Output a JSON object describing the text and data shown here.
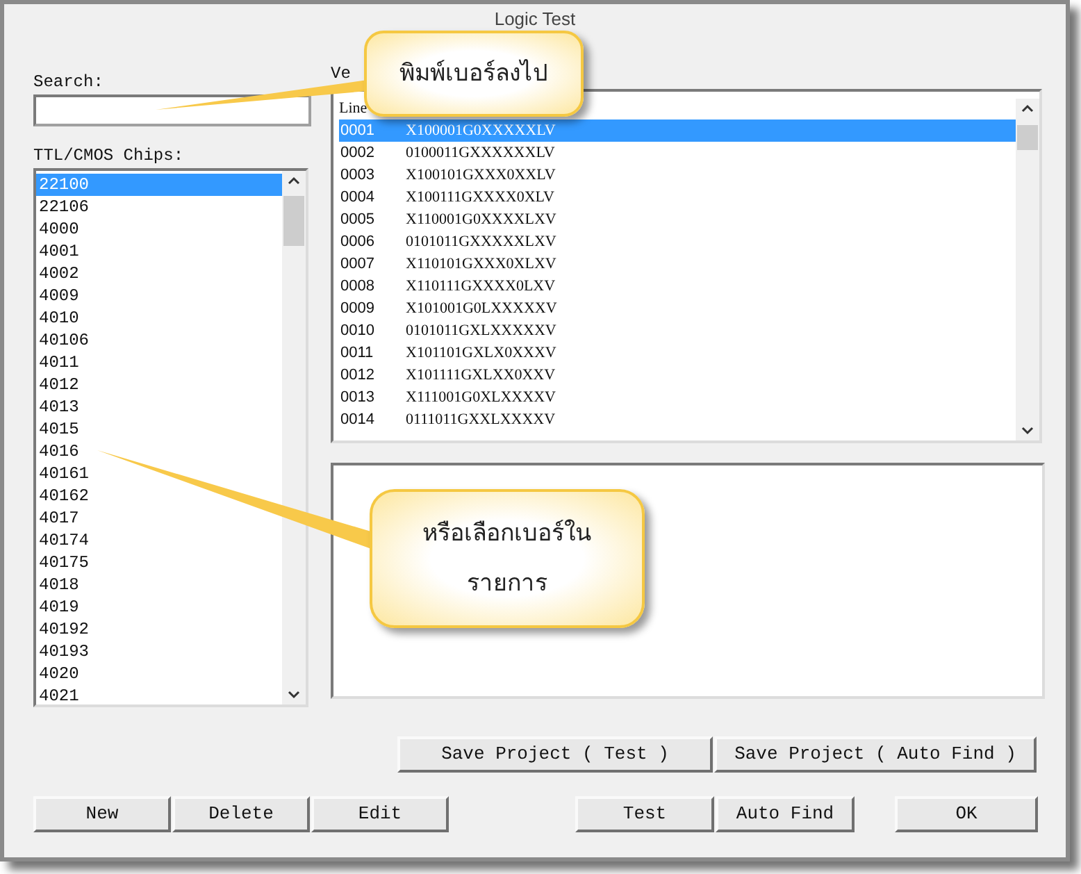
{
  "window": {
    "title": "Logic Test"
  },
  "search": {
    "label": "Search:"
  },
  "chips": {
    "label": "TTL/CMOS Chips:",
    "items": [
      {
        "name": "22100",
        "selected": true
      },
      {
        "name": "22106",
        "selected": false
      },
      {
        "name": "4000",
        "selected": false
      },
      {
        "name": "4001",
        "selected": false
      },
      {
        "name": "4002",
        "selected": false
      },
      {
        "name": "4009",
        "selected": false
      },
      {
        "name": "4010",
        "selected": false
      },
      {
        "name": "40106",
        "selected": false
      },
      {
        "name": "4011",
        "selected": false
      },
      {
        "name": "4012",
        "selected": false
      },
      {
        "name": "4013",
        "selected": false
      },
      {
        "name": "4015",
        "selected": false
      },
      {
        "name": "4016",
        "selected": false
      },
      {
        "name": "40161",
        "selected": false
      },
      {
        "name": "40162",
        "selected": false
      },
      {
        "name": "4017",
        "selected": false
      },
      {
        "name": "40174",
        "selected": false
      },
      {
        "name": "40175",
        "selected": false
      },
      {
        "name": "4018",
        "selected": false
      },
      {
        "name": "4019",
        "selected": false
      },
      {
        "name": "40192",
        "selected": false
      },
      {
        "name": "40193",
        "selected": false
      },
      {
        "name": "4020",
        "selected": false
      },
      {
        "name": "4021",
        "selected": false
      }
    ]
  },
  "vectors": {
    "label": "Ve",
    "header": "Line",
    "rows": [
      {
        "line": "0001",
        "vector": "X100001G0XXXXXLV",
        "selected": true
      },
      {
        "line": "0002",
        "vector": "0100011GXXXXXXLV",
        "selected": false
      },
      {
        "line": "0003",
        "vector": "X100101GXXX0XXLV",
        "selected": false
      },
      {
        "line": "0004",
        "vector": "X100111GXXXX0XLV",
        "selected": false
      },
      {
        "line": "0005",
        "vector": "X110001G0XXXXLXV",
        "selected": false
      },
      {
        "line": "0006",
        "vector": "0101011GXXXXXLXV",
        "selected": false
      },
      {
        "line": "0007",
        "vector": "X110101GXXX0XLXV",
        "selected": false
      },
      {
        "line": "0008",
        "vector": "X110111GXXXX0LXV",
        "selected": false
      },
      {
        "line": "0009",
        "vector": "X101001G0LXXXXXV",
        "selected": false
      },
      {
        "line": "0010",
        "vector": "0101011GXLXXXXXV",
        "selected": false
      },
      {
        "line": "0011",
        "vector": "X101101GXLX0XXXV",
        "selected": false
      },
      {
        "line": "0012",
        "vector": "X101111GXLXX0XXV",
        "selected": false
      },
      {
        "line": "0013",
        "vector": "X111001G0XLXXXXV",
        "selected": false
      },
      {
        "line": "0014",
        "vector": "0111011GXXLXXXXV",
        "selected": false
      }
    ]
  },
  "save_buttons": [
    "Save Project ( Test )",
    "Save Project ( Auto Find )"
  ],
  "left_buttons": [
    "New",
    "Delete",
    "Edit"
  ],
  "right_buttons": [
    "Test",
    "Auto Find"
  ],
  "ok_button": "OK",
  "callouts": [
    "พิมพ์เบอร์ลงไป",
    "หรือเลือกเบอร์ใน รายการ"
  ]
}
